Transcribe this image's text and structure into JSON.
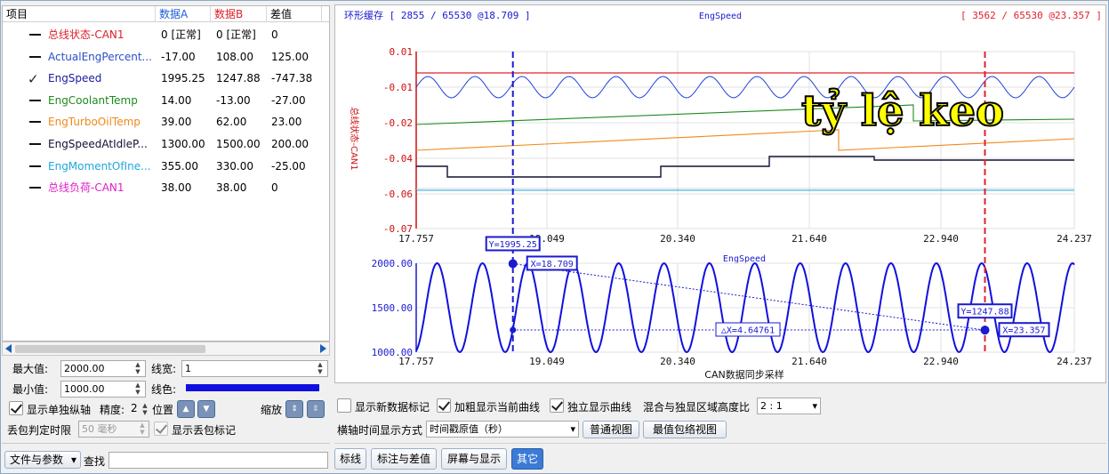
{
  "grid": {
    "headers": [
      "项目",
      "数据A",
      "数据B",
      "差值"
    ],
    "header_colors": [
      "#000000",
      "#1f5fd6",
      "#e0202a",
      "#000000"
    ],
    "rows": [
      {
        "name": "总线状态-CAN1",
        "a": "0 [正常]",
        "b": "0 [正常]",
        "diff": "0",
        "color": "#e0202a",
        "checked": false
      },
      {
        "name": "ActualEngPercent...",
        "a": "-17.00",
        "b": "108.00",
        "diff": "125.00",
        "color": "#2a4fc8",
        "checked": false
      },
      {
        "name": "EngSpeed",
        "a": "1995.25",
        "b": "1247.88",
        "diff": "-747.38",
        "color": "#1a1aa0",
        "checked": true
      },
      {
        "name": "EngCoolantTemp",
        "a": "14.00",
        "b": "-13.00",
        "diff": "-27.00",
        "color": "#1e8a1e",
        "checked": false
      },
      {
        "name": "EngTurboOilTemp",
        "a": "39.00",
        "b": "62.00",
        "diff": "23.00",
        "color": "#f08a1a",
        "checked": false
      },
      {
        "name": "EngSpeedAtIdleP...",
        "a": "1300.00",
        "b": "1500.00",
        "diff": "200.00",
        "color": "#111133",
        "checked": false
      },
      {
        "name": "EngMomentOfIne...",
        "a": "355.00",
        "b": "330.00",
        "diff": "-25.00",
        "color": "#20a8d8",
        "checked": false
      },
      {
        "name": "总线负荷-CAN1",
        "a": "38.00",
        "b": "38.00",
        "diff": "0",
        "color": "#e020c8",
        "checked": false
      }
    ]
  },
  "axis_settings": {
    "max_label": "最大值:",
    "max_value": "2000.00",
    "min_label": "最小值:",
    "min_value": "1000.00",
    "linewidth_label": "线宽:",
    "linewidth_value": "1",
    "color_label": "线色:",
    "line_color": "#1010e0",
    "single_axis_label": "显示单独纵轴",
    "precision_label": "精度:",
    "precision_value": "2",
    "position_label": "位置",
    "zoom_label": "缩放",
    "drop_label": "丢包判定时限",
    "drop_value": "50 毫秒",
    "show_drop_label": "显示丢包标记"
  },
  "bottom_left": {
    "file_params": "文件与参数",
    "search_label": "查找",
    "search_value": ""
  },
  "plot": {
    "ring_label": "环形缓存 [ 2855 / 65530 @18.709 ]",
    "signal_title": "EngSpeed",
    "cursor_b_label": "[ 3562 / 65530 @23.357 ]",
    "top_ylabel": "总线状态-CAN1",
    "top_yticks": [
      "0.01",
      "-0.01",
      "-0.02",
      "-0.04",
      "-0.06",
      "-0.07"
    ],
    "xticks": [
      "17.757",
      "19.049",
      "20.340",
      "21.640",
      "22.940",
      "24.237"
    ],
    "bottom_title": "EngSpeed",
    "bottom_yticks": [
      "2000.00",
      "1500.00",
      "1000.00"
    ],
    "xlabel": "CAN数据同步采样",
    "overlay_text": "tỷ lệ keo",
    "cursor_a_y": "Y=1995.25",
    "cursor_a_x": "X=18.709",
    "cursor_b_y": "Y=1247.88",
    "cursor_b_x": "X=23.357",
    "delta_x": "△X=4.64761"
  },
  "controls": {
    "show_new_marks": "显示新数据标记",
    "bold_current": "加粗显示当前曲线",
    "independent": "独立显示曲线",
    "ratio_label": "混合与独显区域高度比",
    "ratio_value": "2 : 1",
    "time_mode_label": "横轴时间显示方式",
    "time_mode_value": "时间戳原值（秒）",
    "normal_view": "普通视图",
    "envelope_view": "最值包络视图"
  },
  "tabs": [
    "标线",
    "标注与差值",
    "屏幕与显示",
    "其它"
  ],
  "chart_data": {
    "type": "line",
    "title": "EngSpeed",
    "xlabel": "CAN数据同步采样",
    "xlim": [
      17.757,
      24.237
    ],
    "ylim": [
      1000,
      2000
    ],
    "series": [
      {
        "name": "EngSpeed",
        "wave": {
          "min": 1000,
          "max": 2000,
          "cycles": 14.5
        }
      }
    ],
    "cursors": [
      {
        "x": 18.709,
        "y": 1995.25
      },
      {
        "x": 23.357,
        "y": 1247.88
      }
    ]
  }
}
